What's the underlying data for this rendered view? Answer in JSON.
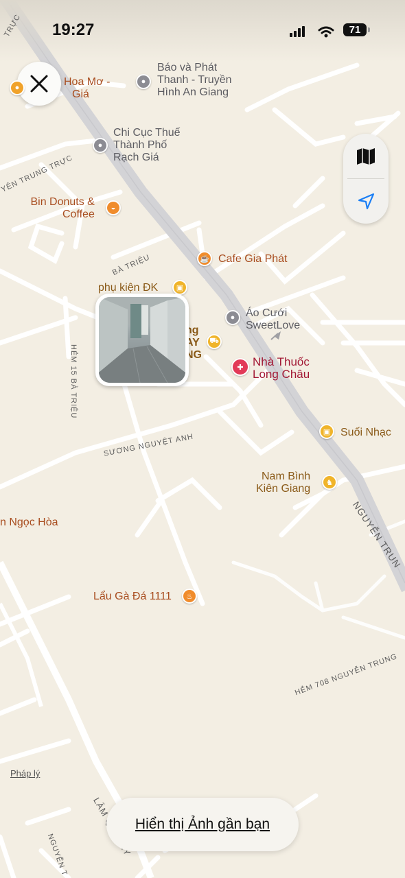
{
  "status_bar": {
    "time": "19:27",
    "battery": "71"
  },
  "map": {
    "places": {
      "hoa_mo": [
        "Hoa Mơ -",
        "Giá"
      ],
      "bao_va_phat_thanh": [
        "Báo và Phát",
        "Thanh - Truyền",
        "Hình An Giang"
      ],
      "chi_cuc_thue": [
        "Chi Cục Thuế",
        "Thành Phố",
        "Rạch Giá"
      ],
      "bin_donuts": [
        "Bin Donuts &",
        "Coffee"
      ],
      "cafe_gia_phat": "Cafe Gia Phát",
      "phu_kien_dk": "phụ kiện ĐK",
      "ao_cuoi": [
        "Áo Cưới",
        "SweetLove"
      ],
      "partial_store": [
        "ng",
        "AY",
        "NG"
      ],
      "nha_thuoc": [
        "Nhà Thuốc",
        "Long Châu"
      ],
      "suoi_nhac": "Suối Nhạc",
      "nam_binh": [
        "Nam Bình",
        "Kiên Giang"
      ],
      "ngoc_hoa": "n Ngọc Hòa",
      "lau_ga": "Lẩu Gà Đá 1111"
    },
    "streets": {
      "nguyen_trung_truc_top": "YÊN TRUNG TRỰC",
      "truc_top": "TRỰC",
      "ba_trieu": "BÀ TRIỆU",
      "hem_15": "HẺM 15 BÀ TRIỆU",
      "suong_nguyet_anh": "SƯƠNG NGUYỆT ANH",
      "nguyen_trung_right": "NGUYỄN TRUN",
      "hem_708": "HẺM 708 NGUYỄN TRUNG",
      "lam_quang_ky": "LÂM QU G KỲ",
      "nguyen_bottom": "NGUYỄN T"
    }
  },
  "legal_link": "Pháp lý",
  "bottom_button": "Hiển thị Ảnh gần bạn",
  "colors": {
    "background": "#f3eee3",
    "main_road": "#d3d3d6",
    "poi_orange": "#f08c2c",
    "poi_red": "#e23a58",
    "poi_gray": "#8c8c93",
    "location_blue": "#1a7ef5"
  }
}
